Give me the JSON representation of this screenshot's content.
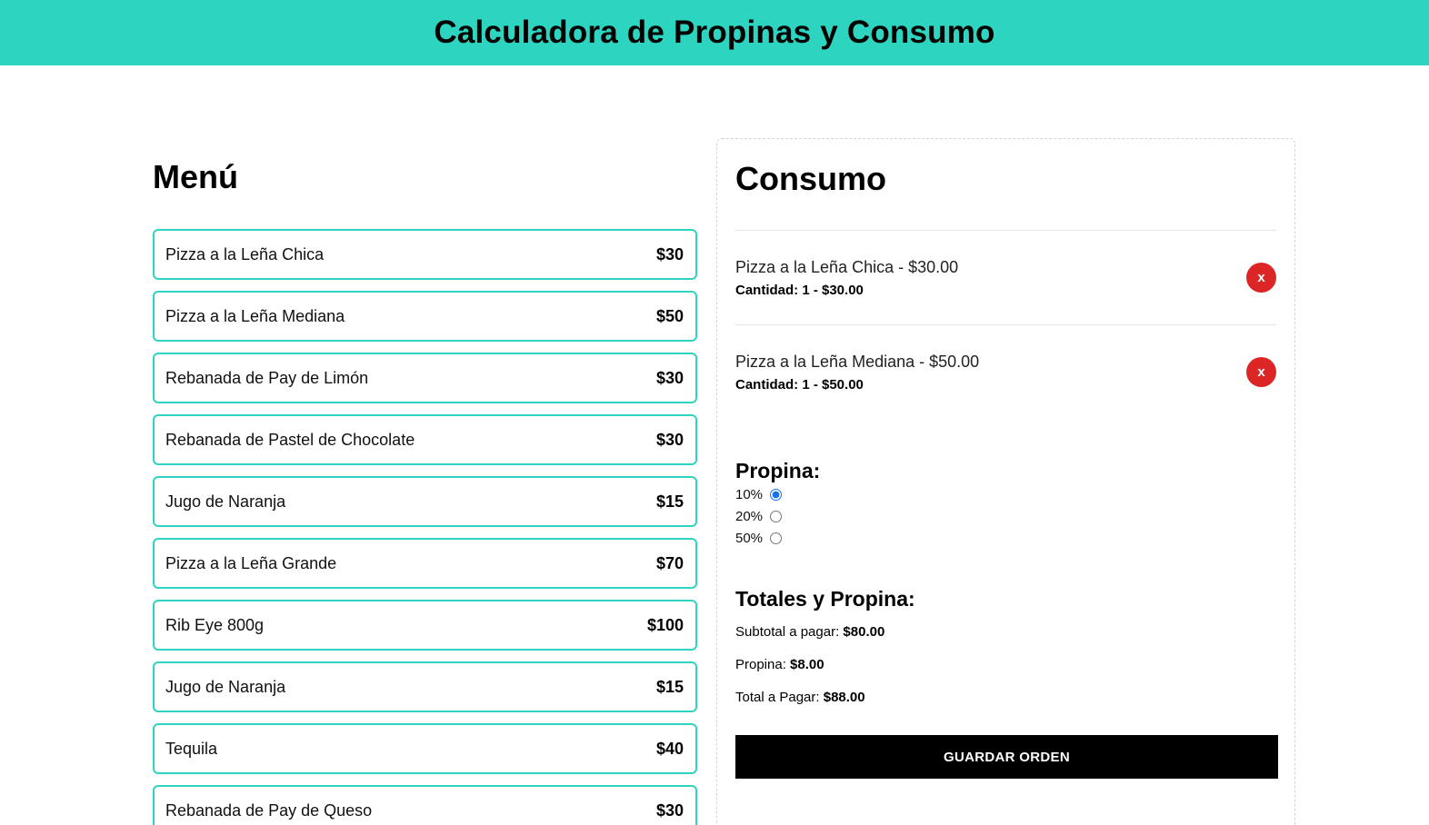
{
  "header": {
    "title": "Calculadora de Propinas y Consumo"
  },
  "menu": {
    "title": "Menú",
    "items": [
      {
        "name": "Pizza a la Leña Chica",
        "price": "$30"
      },
      {
        "name": "Pizza a la Leña Mediana",
        "price": "$50"
      },
      {
        "name": "Rebanada de Pay de Limón",
        "price": "$30"
      },
      {
        "name": "Rebanada de Pastel de Chocolate",
        "price": "$30"
      },
      {
        "name": "Jugo de Naranja",
        "price": "$15"
      },
      {
        "name": "Pizza a la Leña Grande",
        "price": "$70"
      },
      {
        "name": "Rib Eye 800g",
        "price": "$100"
      },
      {
        "name": "Jugo de Naranja",
        "price": "$15"
      },
      {
        "name": "Tequila",
        "price": "$40"
      },
      {
        "name": "Rebanada de Pay de Queso",
        "price": "$30"
      }
    ]
  },
  "consumo": {
    "title": "Consumo",
    "orders": [
      {
        "item_line": "Pizza a la Leña Chica - $30.00",
        "qty_line": "Cantidad: 1 - $30.00",
        "remove_label": "x"
      },
      {
        "item_line": "Pizza a la Leña Mediana - $50.00",
        "qty_line": "Cantidad: 1 - $50.00",
        "remove_label": "x"
      }
    ],
    "tip": {
      "title": "Propina:",
      "options": [
        {
          "label": "10%",
          "checked": true
        },
        {
          "label": "20%",
          "checked": false
        },
        {
          "label": "50%",
          "checked": false
        }
      ]
    },
    "totals": {
      "title": "Totales y Propina:",
      "subtotal_label": "Subtotal a pagar: ",
      "subtotal_value": "$80.00",
      "tip_label": "Propina: ",
      "tip_value": "$8.00",
      "total_label": "Total a Pagar: ",
      "total_value": "$88.00"
    },
    "save_label": "GUARDAR ORDEN"
  },
  "colors": {
    "accent": "#2dd4bf",
    "remove": "#dc2626",
    "button": "#000000"
  }
}
